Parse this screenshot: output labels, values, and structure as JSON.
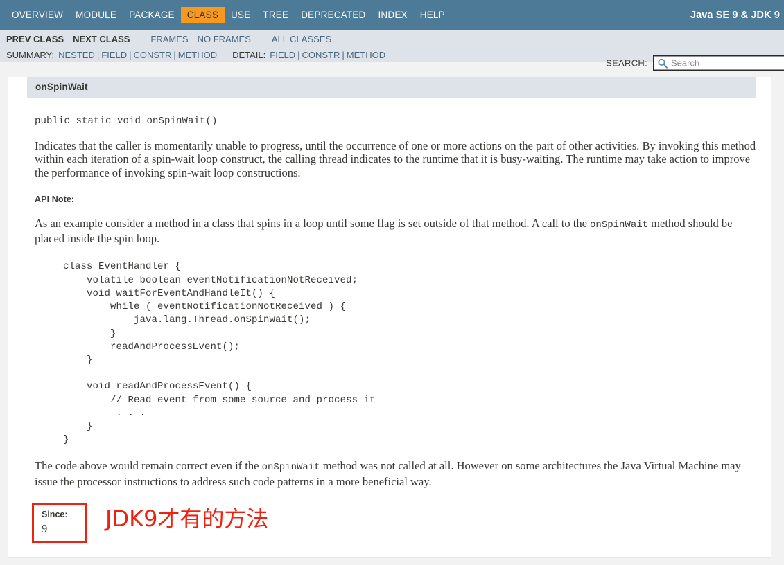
{
  "top_nav": {
    "items": [
      {
        "label": "OVERVIEW",
        "active": false
      },
      {
        "label": "MODULE",
        "active": false
      },
      {
        "label": "PACKAGE",
        "active": false
      },
      {
        "label": "CLASS",
        "active": true
      },
      {
        "label": "USE",
        "active": false
      },
      {
        "label": "TREE",
        "active": false
      },
      {
        "label": "DEPRECATED",
        "active": false
      },
      {
        "label": "INDEX",
        "active": false
      },
      {
        "label": "HELP",
        "active": false
      }
    ],
    "title": "Java SE 9 & JDK 9"
  },
  "sub_nav": {
    "prev_class": "PREV CLASS",
    "next_class": "NEXT CLASS",
    "frames": "FRAMES",
    "no_frames": "NO FRAMES",
    "all_classes": "ALL CLASSES",
    "summary_label": "SUMMARY:",
    "summary_items": [
      "NESTED",
      "FIELD",
      "CONSTR",
      "METHOD"
    ],
    "detail_label": "DETAIL:",
    "detail_items": [
      "FIELD",
      "CONSTR",
      "METHOD"
    ],
    "search_label": "SEARCH:",
    "search_placeholder": "Search",
    "search_value": ""
  },
  "member": {
    "name": "onSpinWait",
    "signature": "public static void onSpinWait()",
    "description": "Indicates that the caller is momentarily unable to progress, until the occurrence of one or more actions on the part of other activities. By invoking this method within each iteration of a spin-wait loop construct, the calling thread indicates to the runtime that it is busy-waiting. The runtime may take action to improve the performance of invoking spin-wait loop constructions.",
    "api_note_label": "API Note:",
    "api_note_text_before": "As an example consider a method in a class that spins in a loop until some flag is set outside of that method. A call to the ",
    "api_note_code": "onSpinWait",
    "api_note_text_after": " method should be placed inside the spin loop.",
    "code_example": "class EventHandler {\n    volatile boolean eventNotificationNotReceived;\n    void waitForEventAndHandleIt() {\n        while ( eventNotificationNotReceived ) {\n            java.lang.Thread.onSpinWait();\n        }\n        readAndProcessEvent();\n    }\n\n    void readAndProcessEvent() {\n        // Read event from some source and process it\n         . . .\n    }\n}",
    "closing_text_before": "The code above would remain correct even if the ",
    "closing_code": "onSpinWait",
    "closing_text_after": " method was not called at all. However on some architectures the Java Virtual Machine may issue the processor instructions to address such code patterns in a more beneficial way.",
    "since_label": "Since:",
    "since_value": "9"
  },
  "annotation": {
    "text": "JDK9才有的方法",
    "color": "#ee2211"
  },
  "colors": {
    "nav_bar": "#4D7A97",
    "active_tab": "#F8981D",
    "sub_nav": "#dee3e9",
    "link": "#4A6782",
    "text": "#353833",
    "annotation_red": "#ee2211"
  }
}
